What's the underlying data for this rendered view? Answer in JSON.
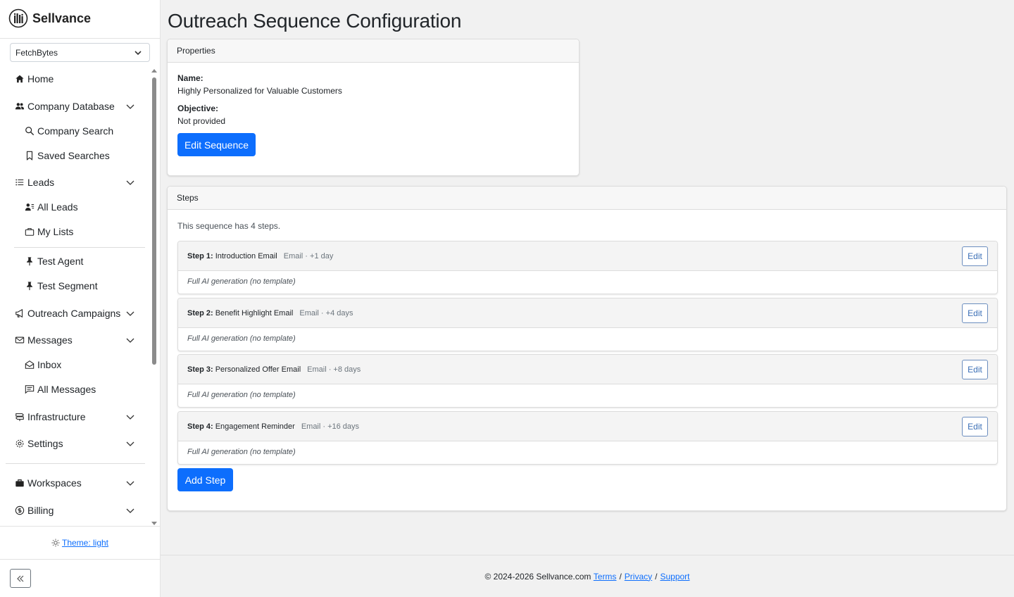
{
  "brand": {
    "name": "Sellvance"
  },
  "workspace_select": {
    "value": "FetchBytes"
  },
  "sidebar": {
    "home": "Home",
    "company_database": "Company Database",
    "company_search": "Company Search",
    "saved_searches": "Saved Searches",
    "leads": "Leads",
    "all_leads": "All Leads",
    "my_lists": "My Lists",
    "test_agent": "Test Agent",
    "test_segment": "Test Segment",
    "outreach_campaigns": "Outreach Campaigns",
    "messages": "Messages",
    "inbox": "Inbox",
    "all_messages": "All Messages",
    "infrastructure": "Infrastructure",
    "settings": "Settings",
    "workspaces": "Workspaces",
    "billing": "Billing"
  },
  "theme": {
    "label": "Theme: light"
  },
  "page": {
    "title": "Outreach Sequence Configuration"
  },
  "properties": {
    "header": "Properties",
    "name_label": "Name:",
    "name_value": "Highly Personalized for Valuable Customers",
    "objective_label": "Objective:",
    "objective_value": "Not provided",
    "edit_button": "Edit Sequence"
  },
  "steps": {
    "header": "Steps",
    "intro": "This sequence has 4 steps.",
    "edit_label": "Edit",
    "add_button": "Add Step",
    "items": [
      {
        "num": "Step 1:",
        "title": "Introduction Email",
        "meta": "Email · +1 day",
        "body": "Full AI generation (no template)"
      },
      {
        "num": "Step 2:",
        "title": "Benefit Highlight Email",
        "meta": "Email · +4 days",
        "body": "Full AI generation (no template)"
      },
      {
        "num": "Step 3:",
        "title": "Personalized Offer Email",
        "meta": "Email · +8 days",
        "body": "Full AI generation (no template)"
      },
      {
        "num": "Step 4:",
        "title": "Engagement Reminder",
        "meta": "Email · +16 days",
        "body": "Full AI generation (no template)"
      }
    ]
  },
  "footer": {
    "copyright": "© 2024-2026 Sellvance.com",
    "terms": "Terms",
    "privacy": "Privacy",
    "support": "Support",
    "sep": "/"
  }
}
